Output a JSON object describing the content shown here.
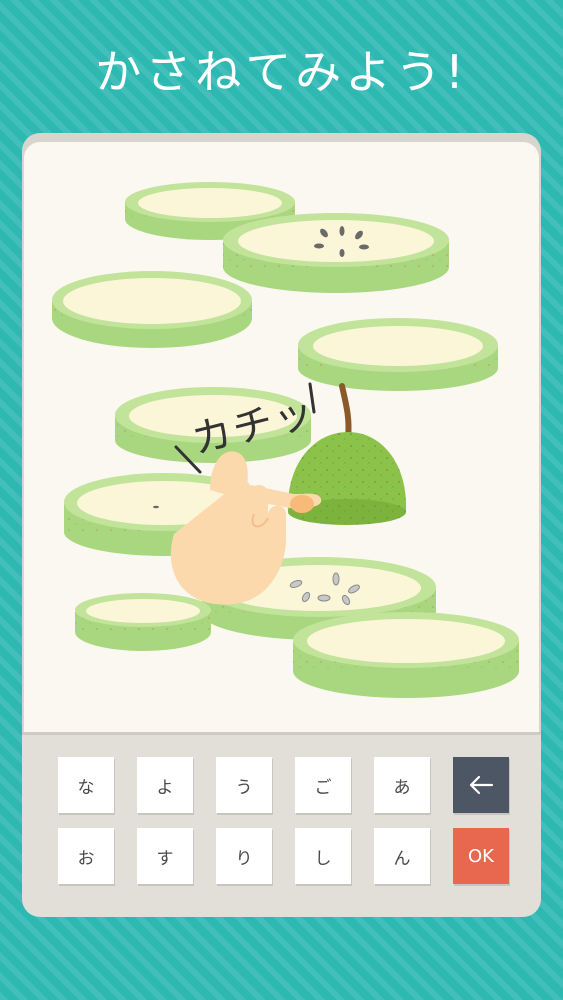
{
  "title": "かさねてみよう!",
  "sfx_text": "カチッ",
  "keys_row1": [
    "な",
    "よ",
    "う",
    "ご",
    "あ"
  ],
  "keys_row2": [
    "お",
    "す",
    "り",
    "し",
    "ん"
  ],
  "back_icon": "back-arrow-icon",
  "ok_label": "OK",
  "colors": {
    "background": "#2db8b2",
    "slice_rim": "#a8d77f",
    "slice_face": "#fbf6d8",
    "pear_skin": "#8bc34a",
    "ok_button": "#e8674f",
    "back_button": "#4d5665"
  }
}
